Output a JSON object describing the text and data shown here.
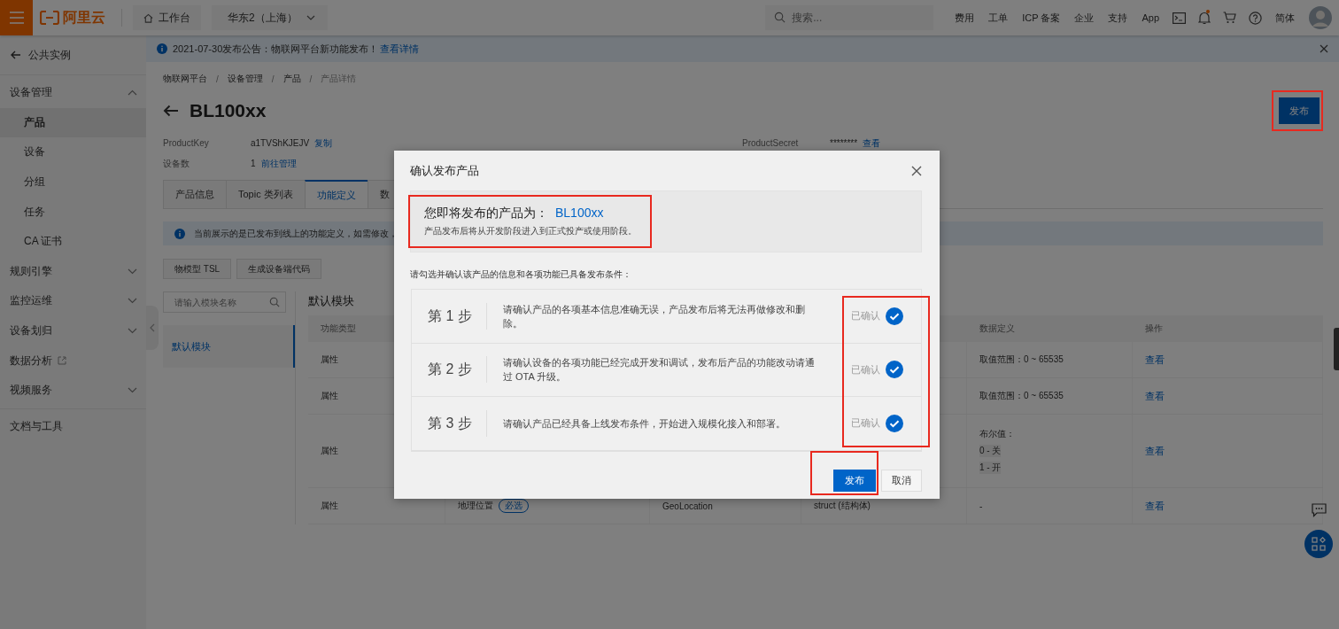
{
  "topbar": {
    "logo": "阿里云",
    "workbench": "工作台",
    "region": "华东2（上海）",
    "search": {
      "placeholder": "搜索..."
    },
    "links": [
      "费用",
      "工单",
      "ICP 备案",
      "企业",
      "支持",
      "App"
    ],
    "bell_badge": true,
    "language": "简体"
  },
  "notice": {
    "text": "2021-07-30发布公告：物联网平台新功能发布！",
    "link": "查看详情"
  },
  "sidebar": {
    "back": "公共实例",
    "sections": [
      [
        {
          "label": "设备管理",
          "kind": "menu",
          "expanded": true,
          "children": [
            {
              "label": "产品",
              "selected": true
            },
            {
              "label": "设备",
              "selected": false
            },
            {
              "label": "分组",
              "selected": false
            },
            {
              "label": "任务",
              "selected": false
            },
            {
              "label": "CA 证书",
              "selected": false
            }
          ]
        },
        {
          "label": "规则引擎",
          "kind": "menu",
          "expanded": false
        },
        {
          "label": "监控运维",
          "kind": "menu",
          "expanded": false
        },
        {
          "label": "设备划归",
          "kind": "menu",
          "expanded": false
        },
        {
          "label": "数据分析",
          "kind": "external"
        },
        {
          "label": "视频服务",
          "kind": "menu",
          "expanded": false
        }
      ],
      [
        {
          "label": "文档与工具",
          "kind": "plain"
        }
      ]
    ]
  },
  "breadcrumb": {
    "items": [
      "物联网平台",
      "设备管理",
      "产品",
      "产品详情"
    ],
    "separator": "/"
  },
  "title": "BL100xx",
  "publish_button": {
    "label": "发布",
    "annotated": true
  },
  "info": [
    {
      "label": "ProductKey",
      "value": "a1TVShKJEJV",
      "link": "复制"
    },
    {
      "label": "设备数",
      "value": "1",
      "link": "前往管理"
    }
  ],
  "secret": {
    "label": "ProductSecret",
    "value": "********",
    "link": "查看"
  },
  "tabs": [
    {
      "label": "产品信息",
      "selected": false
    },
    {
      "label": "Topic 类列表",
      "selected": false
    },
    {
      "label": "功能定义",
      "selected": true
    },
    {
      "label": "数",
      "selected": false
    }
  ],
  "alert": "当前展示的是已发布到线上的功能定义，如需修改，",
  "tool_buttons": [
    "物模型 TSL",
    "生成设备端代码"
  ],
  "module_search": {
    "placeholder": "请输入模块名称"
  },
  "modules": [
    {
      "label": "默认模块",
      "selected": true
    }
  ],
  "module_heading": "默认模块",
  "table": {
    "columns": [
      {
        "label": "功能类型"
      },
      {},
      {},
      {},
      {
        "label": "数据定义"
      },
      {
        "label": "操作"
      }
    ],
    "rows": [
      {
        "cells": [
          {
            "text": "属性"
          },
          {},
          {},
          {},
          {
            "text": "取值范围：0 ~ 65535"
          },
          {
            "text": "查看",
            "kind": "link"
          }
        ]
      },
      {
        "cells": [
          {
            "text": "属性"
          },
          {},
          {},
          {},
          {
            "text": "取值范围：0 ~ 65535"
          },
          {
            "text": "查看",
            "kind": "link"
          }
        ]
      },
      {
        "cells": [
          {
            "text": "属性"
          },
          {},
          {},
          {},
          {
            "text": "布尔值：",
            "tags": [
              "0 - 关",
              "1 - 开"
            ]
          },
          {
            "text": "查看",
            "kind": "link"
          }
        ]
      },
      {
        "cells": [
          {
            "text": "属性"
          },
          {
            "text": "地理位置",
            "tag": "必选"
          },
          {
            "text": "GeoLocation"
          },
          {
            "text": "struct (结构体)"
          },
          {
            "text": "-"
          },
          {
            "text": "查看",
            "kind": "link"
          }
        ]
      }
    ]
  },
  "modal": {
    "title": "确认发布产品",
    "intro": {
      "lead": "您即将发布的产品为：",
      "product": "BL100xx",
      "note": "产品发布后将从开发阶段进入到正式投产或使用阶段。",
      "annotated": true
    },
    "instruction": "请勾选并确认该产品的信息和各项功能已具备发布条件：",
    "steps": [
      {
        "label": "第 1 步",
        "text": "请确认产品的各项基本信息准确无误，产品发布后将无法再做修改和删除。",
        "status": "已确认",
        "checked": true
      },
      {
        "label": "第 2 步",
        "text": "请确认设备的各项功能已经完成开发和调试，发布后产品的功能改动请通过 OTA 升级。",
        "status": "已确认",
        "checked": true
      },
      {
        "label": "第 3 步",
        "text": "请确认产品已经具备上线发布条件，开始进入规模化接入和部署。",
        "status": "已确认",
        "checked": true
      }
    ],
    "confirm_annotated": true,
    "publish": {
      "label": "发布",
      "annotated": true
    },
    "cancel": "取消"
  }
}
